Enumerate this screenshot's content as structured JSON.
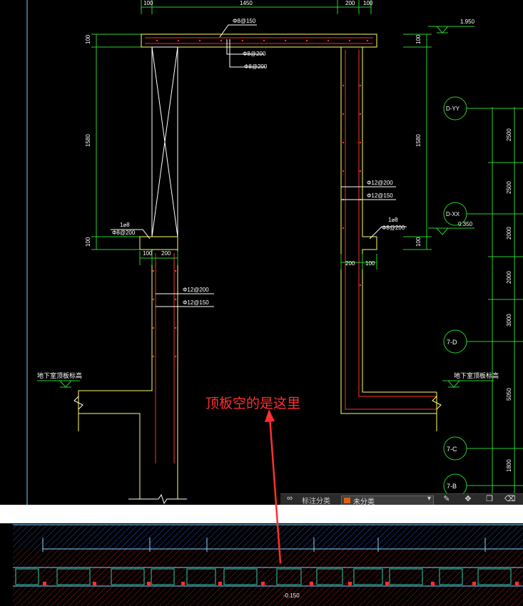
{
  "section": {
    "dim_top_left": "100",
    "dim_top_mid": "1450",
    "dim_top_r1": "200",
    "dim_top_r2": "100",
    "dim_left_100a": "100",
    "dim_left_1580": "1580",
    "dim_left_100b": "100",
    "dim_right_100a": "100",
    "dim_right_1580": "1580",
    "dim_right_100b": "100",
    "bar_top_slab": "Φ8@150",
    "bar_top_1": "Φ8@200",
    "bar_top_2": "Φ8@200",
    "bar_left_corner_1": "1⌀8",
    "bar_left_corner_2": "Φ8@200",
    "bar_right_corner_1": "1⌀8",
    "bar_right_corner_2": "Φ8@200",
    "bar_right_wall_1": "Φ12@200",
    "bar_right_wall_2": "Φ12@150",
    "bar_left_wall_1": "Φ12@200",
    "bar_left_wall_2": "Φ12@150",
    "wall_left_100": "100",
    "wall_left_200": "200",
    "wall_right_200": "200",
    "wall_right_100": "100",
    "level_top": "1.950",
    "level_mid": "0.350",
    "basement_left": "地下室顶板标高",
    "basement_right": "地下室顶板标高"
  },
  "axes": [
    {
      "label": "D-YY"
    },
    {
      "label": "D-XX"
    },
    {
      "label": "7-D"
    },
    {
      "label": "7-C"
    },
    {
      "label": "7-B"
    }
  ],
  "axis_dims": [
    "2500",
    "2500",
    "2000",
    "2000",
    "3000",
    "5050",
    "1800"
  ],
  "annotation": "顶板空的是这里",
  "toolbar": {
    "label": "标注分类",
    "select_value": "未分类",
    "swatch_color": "#e06010"
  },
  "plan": {
    "level_text": "-0.150"
  },
  "colors": {
    "annotation": "#ff3030",
    "background": "#000000"
  }
}
